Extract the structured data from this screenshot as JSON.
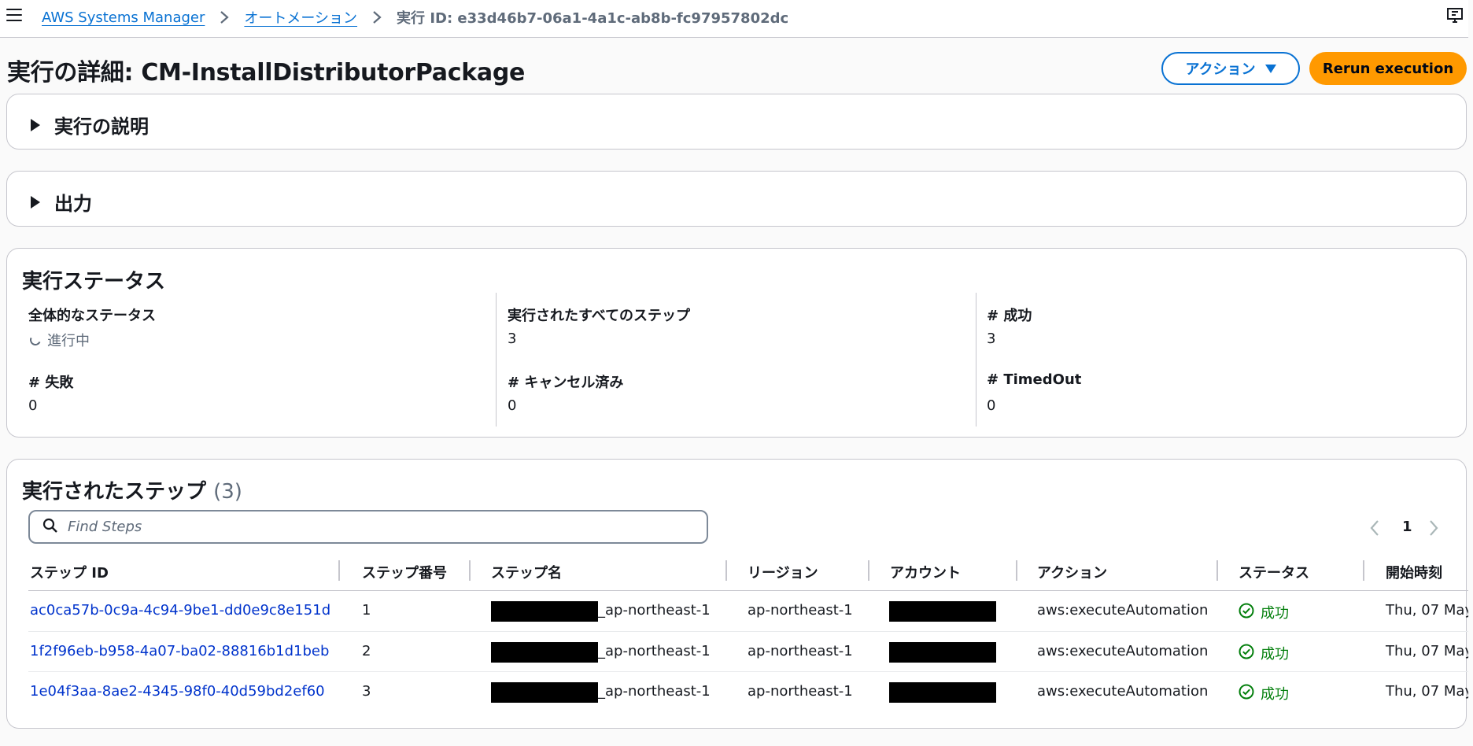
{
  "breadcrumb": {
    "service": "AWS Systems Manager",
    "section": "オートメーション",
    "current": "実行 ID: e33d46b7-06a1-4a1c-ab8b-fc97957802dc"
  },
  "header": {
    "title": "実行の詳細: CM-InstallDistributorPackage",
    "actions_label": "アクション",
    "rerun_label": "Rerun execution"
  },
  "panels": {
    "description_label": "実行の説明",
    "output_label": "出力"
  },
  "status": {
    "title": "実行ステータス",
    "overall_label": "全体的なステータス",
    "overall_value": "進行中",
    "executed_label": "実行されたすべてのステップ",
    "executed_value": "3",
    "success_label": "# 成功",
    "success_value": "3",
    "failed_label": "# 失敗",
    "failed_value": "0",
    "cancelled_label": "# キャンセル済み",
    "cancelled_value": "0",
    "timedout_label": "# TimedOut",
    "timedout_value": "0"
  },
  "steps": {
    "title": "実行されたステップ",
    "count": "(3)",
    "search_placeholder": "Find Steps",
    "page": "1",
    "columns": [
      "ステップ ID",
      "ステップ番号",
      "ステップ名",
      "リージョン",
      "アカウント",
      "アクション",
      "ステータス",
      "開始時刻"
    ],
    "rows": [
      {
        "id": "ac0ca57b-0c9a-4c94-9be1-dd0e9c8e151d",
        "num": "1",
        "name_suffix": "_ap-northeast-1",
        "region": "ap-northeast-1",
        "action": "aws:executeAutomation",
        "status": "成功",
        "start": "Thu, 07 May"
      },
      {
        "id": "1f2f96eb-b958-4a07-ba02-88816b1d1beb",
        "num": "2",
        "name_suffix": "_ap-northeast-1",
        "region": "ap-northeast-1",
        "action": "aws:executeAutomation",
        "status": "成功",
        "start": "Thu, 07 May"
      },
      {
        "id": "1e04f3aa-8ae2-4345-98f0-40d59bd2ef60",
        "num": "3",
        "name_suffix": "_ap-northeast-1",
        "region": "ap-northeast-1",
        "action": "aws:executeAutomation",
        "status": "成功",
        "start": "Thu, 07 May"
      }
    ]
  },
  "colors": {
    "link": "#0972d3",
    "primary_button": "#ff9900",
    "success": "#037f0c",
    "border": "#c6c6cd"
  },
  "icons": [
    "menu-icon",
    "chevron-right-icon",
    "screen-feedback-icon",
    "caret-down-icon",
    "caret-right-icon",
    "spinner-icon",
    "search-icon",
    "chevron-left-icon",
    "check-circle-icon"
  ]
}
